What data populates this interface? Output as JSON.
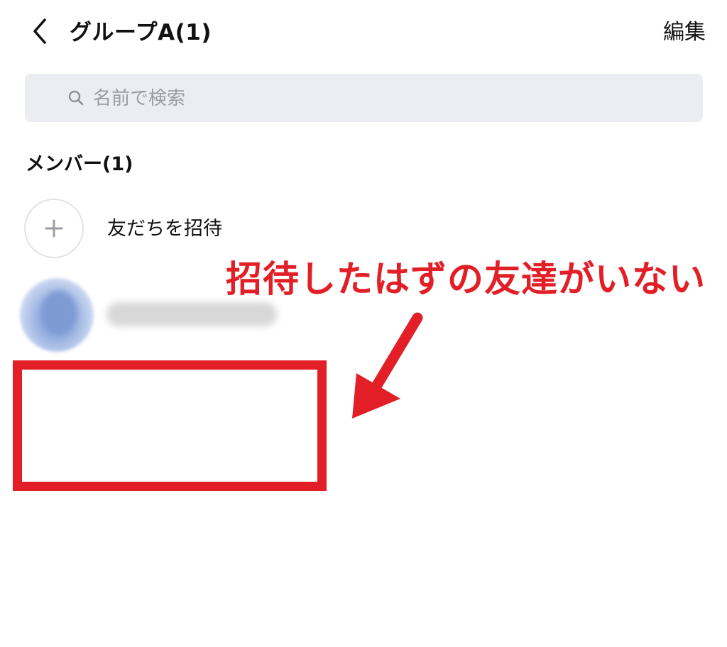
{
  "header": {
    "back_icon": "chevron-left-icon",
    "title": "グループA(1)",
    "edit_label": "編集"
  },
  "search": {
    "icon": "search-icon",
    "placeholder": "名前で検索",
    "value": ""
  },
  "members": {
    "section_label": "メンバー(1)",
    "invite": {
      "icon": "plus-icon",
      "label": "友だちを招待"
    },
    "items": [
      {
        "name": "",
        "avatar": "avatar-blurred",
        "blurred": true
      }
    ]
  },
  "annotation": {
    "text": "招待したはずの友達がいない",
    "color": "#e21f26"
  },
  "colors": {
    "search_bg": "#ecedf2",
    "accent_red": "#e21f26",
    "placeholder": "#9a9ca4"
  }
}
